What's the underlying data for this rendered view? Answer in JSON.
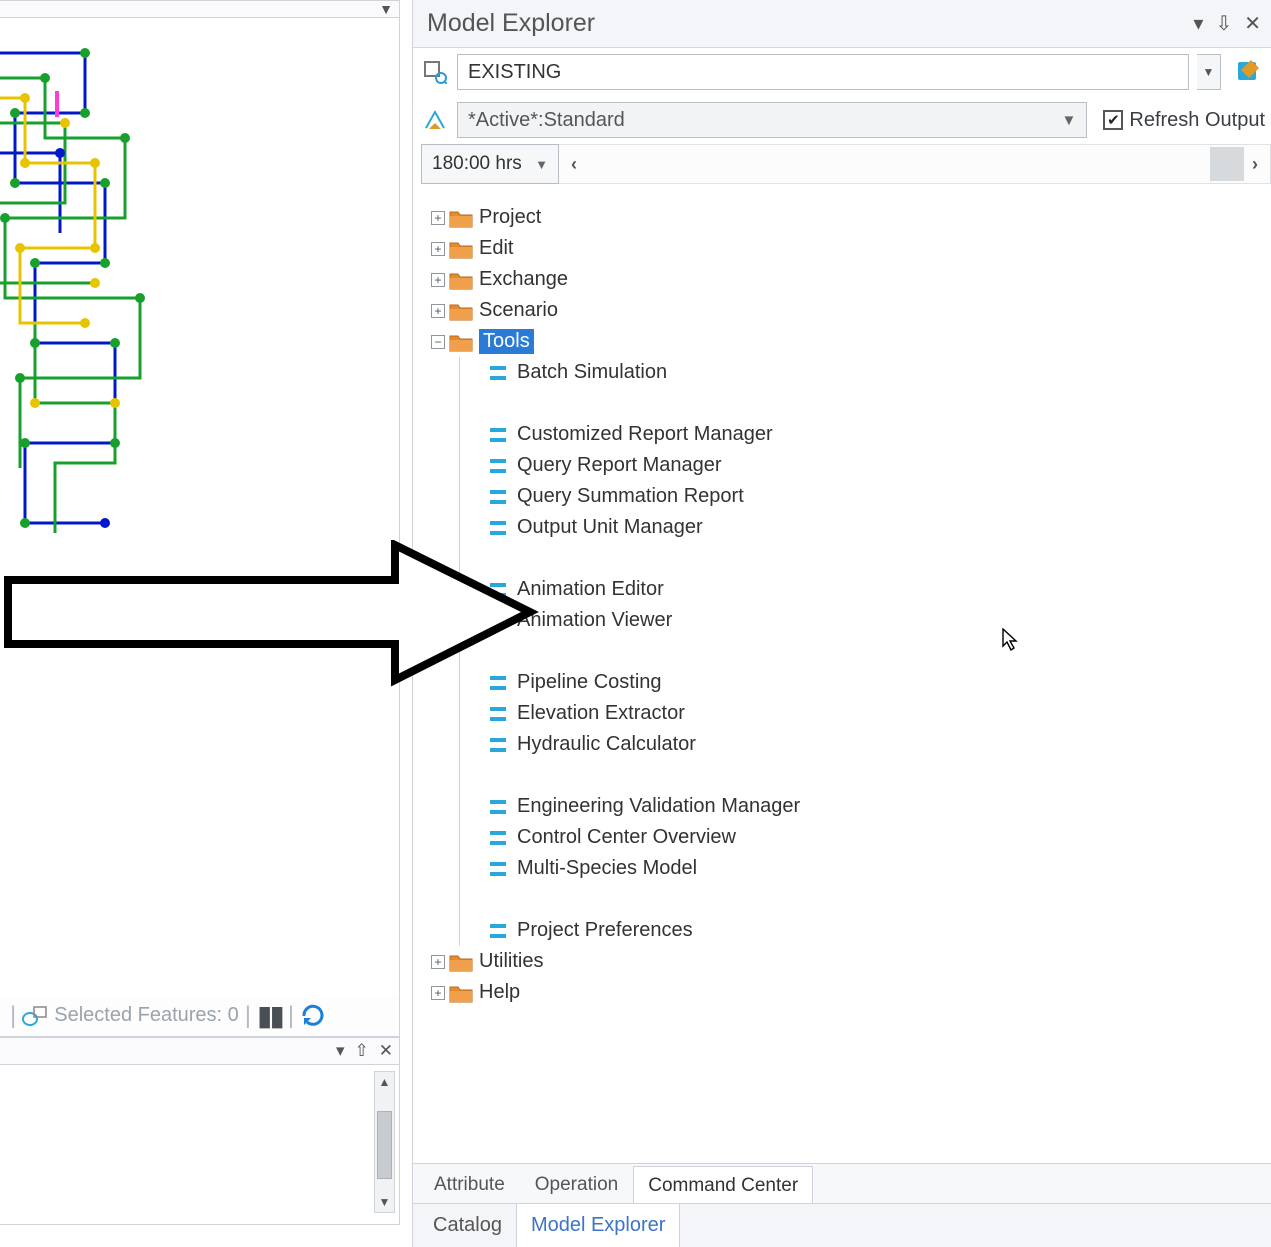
{
  "panel_title": "Model Explorer",
  "scenario_value": "EXISTING",
  "active_value": "*Active*:Standard",
  "refresh_label": "Refresh Output",
  "time_value": "180:00 hrs",
  "tree": {
    "roots": [
      {
        "label": "Project",
        "expanded": false
      },
      {
        "label": "Edit",
        "expanded": false
      },
      {
        "label": "Exchange",
        "expanded": false
      },
      {
        "label": "Scenario",
        "expanded": false
      },
      {
        "label": "Tools",
        "expanded": true,
        "selected": true
      },
      {
        "label": "Utilities",
        "expanded": false
      },
      {
        "label": "Help",
        "expanded": false
      }
    ],
    "tools_children": [
      "Batch Simulation",
      "",
      "Customized Report Manager",
      "Query Report Manager",
      "Query Summation Report",
      "Output Unit Manager",
      "",
      "Animation Editor",
      "Animation Viewer",
      "",
      "Pipeline Costing",
      "Elevation Extractor",
      "Hydraulic Calculator",
      "",
      "Engineering Validation Manager",
      "Control Center Overview",
      "Multi-Species Model",
      "",
      "Project Preferences"
    ]
  },
  "status_bar": {
    "selected_label": "Selected Features: 0"
  },
  "tabs_upper": [
    "Attribute",
    "Operation",
    "Command Center"
  ],
  "tabs_upper_active": "Command Center",
  "tabs_lower": [
    "Catalog",
    "Model Explorer"
  ],
  "tabs_lower_active": "Model Explorer"
}
